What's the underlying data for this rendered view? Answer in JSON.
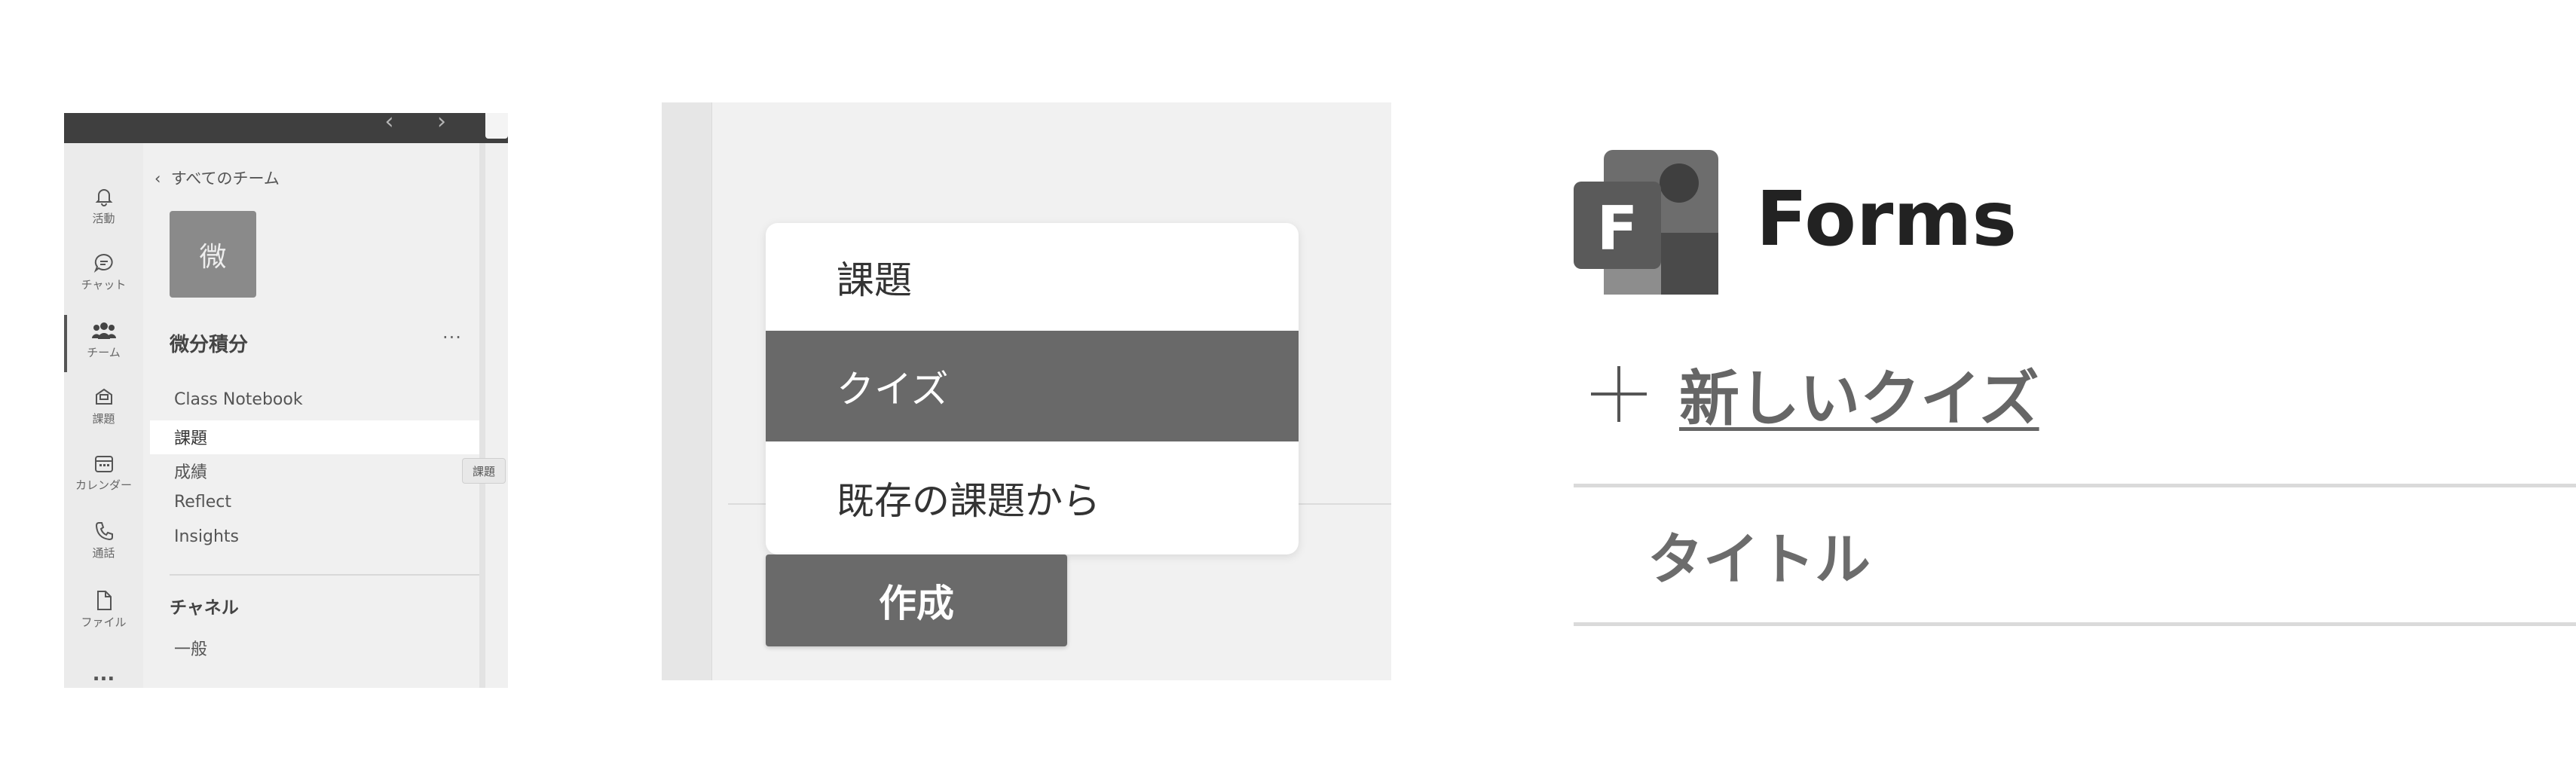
{
  "teams_sidebar": {
    "rail": [
      {
        "icon": "bell-icon",
        "label": "活動"
      },
      {
        "icon": "chat-icon",
        "label": "チャット"
      },
      {
        "icon": "teams-icon",
        "label": "チーム"
      },
      {
        "icon": "assignments-icon",
        "label": "課題"
      },
      {
        "icon": "calendar-icon",
        "label": "カレンダー"
      },
      {
        "icon": "phone-icon",
        "label": "通話"
      },
      {
        "icon": "file-icon",
        "label": "ファイル"
      },
      {
        "icon": "more-icon",
        "label": "..."
      }
    ],
    "back_label": "すべてのチーム",
    "team_avatar_char": "微",
    "team_name": "微分積分",
    "more_label": "···",
    "links": [
      "Class Notebook",
      "課題",
      "成績",
      "Reflect",
      "Insights"
    ],
    "selected_link": "課題",
    "tooltip": "課題",
    "channels_heading": "チャネル",
    "channel_general": "一般"
  },
  "create_menu": {
    "items": [
      "課題",
      "クイズ",
      "既存の課題から"
    ],
    "selected_item": "クイズ",
    "create_button": "作成"
  },
  "forms": {
    "app_name": "Forms",
    "logo_letter": "F",
    "new_quiz_label": "新しいクイズ",
    "title_placeholder": "タイトル"
  }
}
